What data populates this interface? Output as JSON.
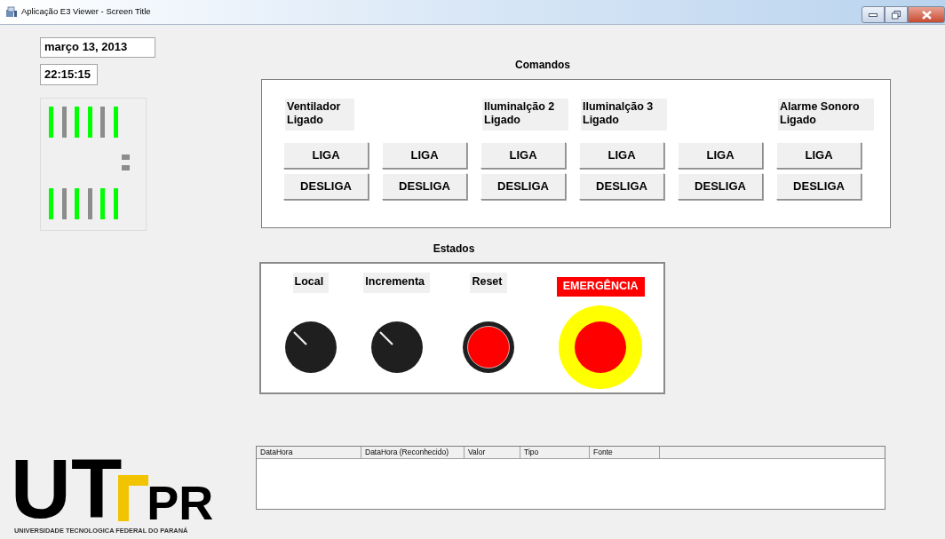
{
  "window": {
    "title": "Aplicação E3 Viewer - Screen Title"
  },
  "date": "março 13, 2013",
  "time": "22:15:15",
  "indicator": {
    "top": [
      {
        "on": true
      },
      {
        "on": false
      },
      {
        "on": true
      },
      {
        "on": true
      },
      {
        "on": false
      },
      {
        "on": true
      }
    ],
    "bottom": [
      {
        "on": true
      },
      {
        "on": false
      },
      {
        "on": true
      },
      {
        "on": false
      },
      {
        "on": true
      },
      {
        "on": true
      }
    ]
  },
  "commands": {
    "title": "Comandos",
    "columns": [
      {
        "label": "Ventilador",
        "status": "Ligado",
        "buttons": [
          "LIGA",
          "DESLIGA"
        ]
      },
      {
        "buttons": [
          "LIGA",
          "DESLIGA"
        ]
      },
      {
        "label": "Iluminalção 2",
        "status": "Ligado",
        "buttons": [
          "LIGA",
          "DESLIGA"
        ]
      },
      {
        "label": "Iluminalção 3",
        "status": "Ligado",
        "buttons": [
          "LIGA",
          "DESLIGA"
        ]
      },
      {
        "buttons": [
          "LIGA",
          "DESLIGA"
        ]
      },
      {
        "label": "Alarme Sonoro",
        "status": "Ligado",
        "buttons": [
          "LIGA",
          "DESLIGA"
        ]
      }
    ]
  },
  "states": {
    "title": "Estados",
    "controls": [
      {
        "kind": "knob",
        "label": "Local"
      },
      {
        "kind": "knob",
        "label": "Incrementa"
      },
      {
        "kind": "button",
        "label": "Reset"
      },
      {
        "kind": "emergency",
        "label": "EMERGÊNCIA"
      }
    ]
  },
  "alarm_table": {
    "columns": [
      "DataHora",
      "DataHora (Reconhecido)",
      "Valor",
      "Tipo",
      "Fonte"
    ]
  },
  "logo": {
    "left": "UT",
    "right": "PR",
    "subtitle": "UNIVERSIDADE TECNOLOGICA FEDERAL DO PARANÁ"
  }
}
